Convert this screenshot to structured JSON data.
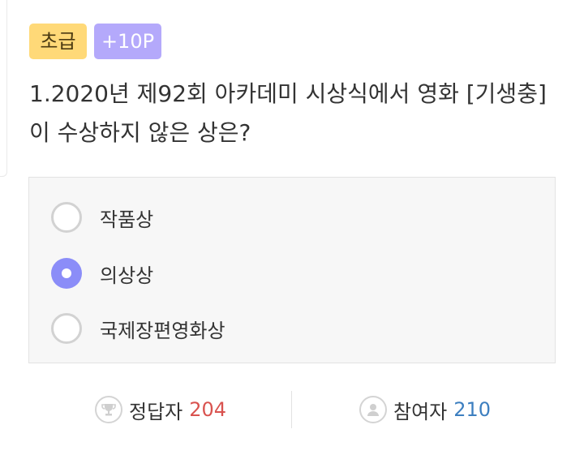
{
  "quiz": {
    "level_badge": "초급",
    "points_badge": "+10P",
    "question": "1.2020년 제92회 아카데미 시상식에서 영화 [기생충]이 수상하지 않은 상은?",
    "options": [
      {
        "label": "작품상",
        "selected": false
      },
      {
        "label": "의상상",
        "selected": true
      },
      {
        "label": "국제장편영화상",
        "selected": false
      }
    ]
  },
  "stats": {
    "correct_label": "정답자",
    "correct_count": "204",
    "participants_label": "참여자",
    "participants_count": "210"
  },
  "icons": {
    "correct": "trophy-icon",
    "participants": "person-icon"
  },
  "colors": {
    "level_badge": "#ffd978",
    "points_badge": "#b4a9fb",
    "selected_radio": "#8b8df8",
    "correct_count": "#d9534f",
    "participants_count": "#3d7fc0"
  }
}
